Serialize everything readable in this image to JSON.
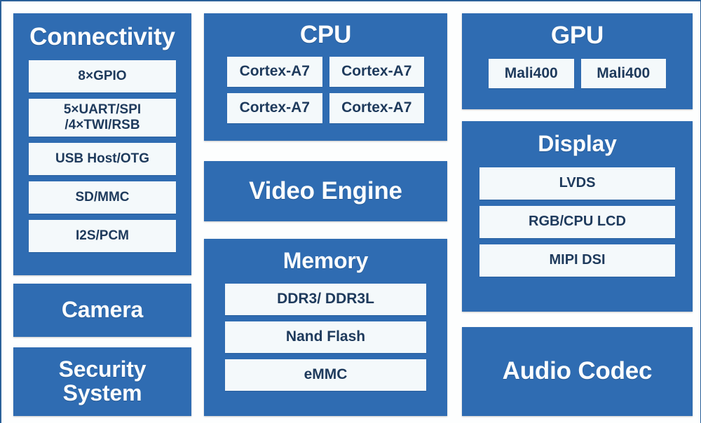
{
  "theme": {
    "panel_blue": "#2f6cb2",
    "item_bg": "#f4f9fb",
    "item_text": "#1e3a5c",
    "title_text": "#fbfdfe",
    "frame_border": "#2a6099",
    "page_bg": "#fdfefe"
  },
  "diagram": {
    "type": "block-diagram",
    "columns": [
      {
        "id": "column-left",
        "panels": [
          {
            "id": "connectivity",
            "title": "Connectivity",
            "items": [
              {
                "label": "8×GPIO"
              },
              {
                "label": "5×UART/SPI\n/4×TWI/RSB"
              },
              {
                "label": "USB Host/OTG"
              },
              {
                "label": "SD/MMC"
              },
              {
                "label": "I2S/PCM"
              }
            ]
          },
          {
            "id": "camera",
            "title": "Camera",
            "items": []
          },
          {
            "id": "security-system",
            "title": "Security\nSystem",
            "items": []
          }
        ]
      },
      {
        "id": "column-center",
        "panels": [
          {
            "id": "cpu",
            "title": "CPU",
            "items": [
              {
                "label": "Cortex-A7"
              },
              {
                "label": "Cortex-A7"
              },
              {
                "label": "Cortex-A7"
              },
              {
                "label": "Cortex-A7"
              }
            ]
          },
          {
            "id": "video-engine",
            "title": "Video Engine",
            "items": []
          },
          {
            "id": "memory",
            "title": "Memory",
            "items": [
              {
                "label": "DDR3/ DDR3L"
              },
              {
                "label": "Nand Flash"
              },
              {
                "label": "eMMC"
              }
            ]
          }
        ]
      },
      {
        "id": "column-right",
        "panels": [
          {
            "id": "gpu",
            "title": "GPU",
            "items": [
              {
                "label": "Mali400"
              },
              {
                "label": "Mali400"
              }
            ]
          },
          {
            "id": "display",
            "title": "Display",
            "items": [
              {
                "label": "LVDS"
              },
              {
                "label": "RGB/CPU LCD"
              },
              {
                "label": "MIPI DSI"
              }
            ]
          },
          {
            "id": "audio-codec",
            "title": "Audio Codec",
            "items": []
          }
        ]
      }
    ]
  }
}
